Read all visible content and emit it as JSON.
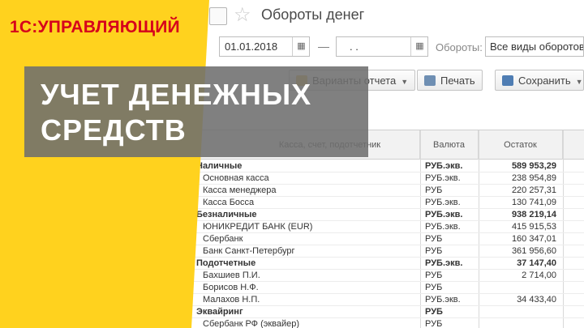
{
  "window": {
    "title": "Обороты денег"
  },
  "filter": {
    "date_from": "01.01.2018",
    "date_to": ". .",
    "dash": "—",
    "turnover_label": "Обороты:",
    "turnover_value": "Все виды оборотов"
  },
  "toolbar": {
    "variants_label": "Варианты отчета",
    "print_label": "Печать",
    "save_label": "Сохранить"
  },
  "grid": {
    "col_account": "Касса, счет, подотчетник",
    "col_currency": "Валюта",
    "col_balance": "Остаток",
    "rows": [
      {
        "name": "Наличные",
        "currency": "РУБ.экв.",
        "balance": "589 953,29"
      },
      {
        "name": "Основная касса",
        "currency": "РУБ.экв.",
        "balance": "238 954,89"
      },
      {
        "name": "Касса менеджера",
        "currency": "РУБ",
        "balance": "220 257,31"
      },
      {
        "name": "Касса Босса",
        "currency": "РУБ.экв.",
        "balance": "130 741,09"
      },
      {
        "name": "Безналичные",
        "currency": "РУБ.экв.",
        "balance": "938 219,14"
      },
      {
        "name": "ЮНИКРЕДИТ БАНК (EUR)",
        "currency": "РУБ.экв.",
        "balance": "415 915,53"
      },
      {
        "name": "Сбербанк",
        "currency": "РУБ",
        "balance": "160 347,01"
      },
      {
        "name": "Банк Санкт-Петербург",
        "currency": "РУБ",
        "balance": "361 956,60"
      },
      {
        "name": "Подотчетные",
        "currency": "РУБ.экв.",
        "balance": "37 147,40"
      },
      {
        "name": "Бахшиев П.И.",
        "currency": "РУБ",
        "balance": "2 714,00"
      },
      {
        "name": "Борисов Н.Ф.",
        "currency": "РУБ",
        "balance": ""
      },
      {
        "name": "Малахов Н.П.",
        "currency": "РУБ.экв.",
        "balance": "34 433,40"
      },
      {
        "name": "Эквайринг",
        "currency": "РУБ",
        "balance": ""
      },
      {
        "name": "Сбербанк РФ (эквайер)",
        "currency": "РУБ",
        "balance": ""
      }
    ]
  },
  "promo": {
    "brand": "1С:УПРАВЛЯЮЩИЙ",
    "line1": "УЧЕТ ДЕНЕЖНЫХ",
    "line2": "СРЕДСТВ"
  },
  "colors": {
    "yellow": "#FFD21E",
    "brand_red": "#D6001C",
    "overlay_gray": "#6E6E6E"
  }
}
